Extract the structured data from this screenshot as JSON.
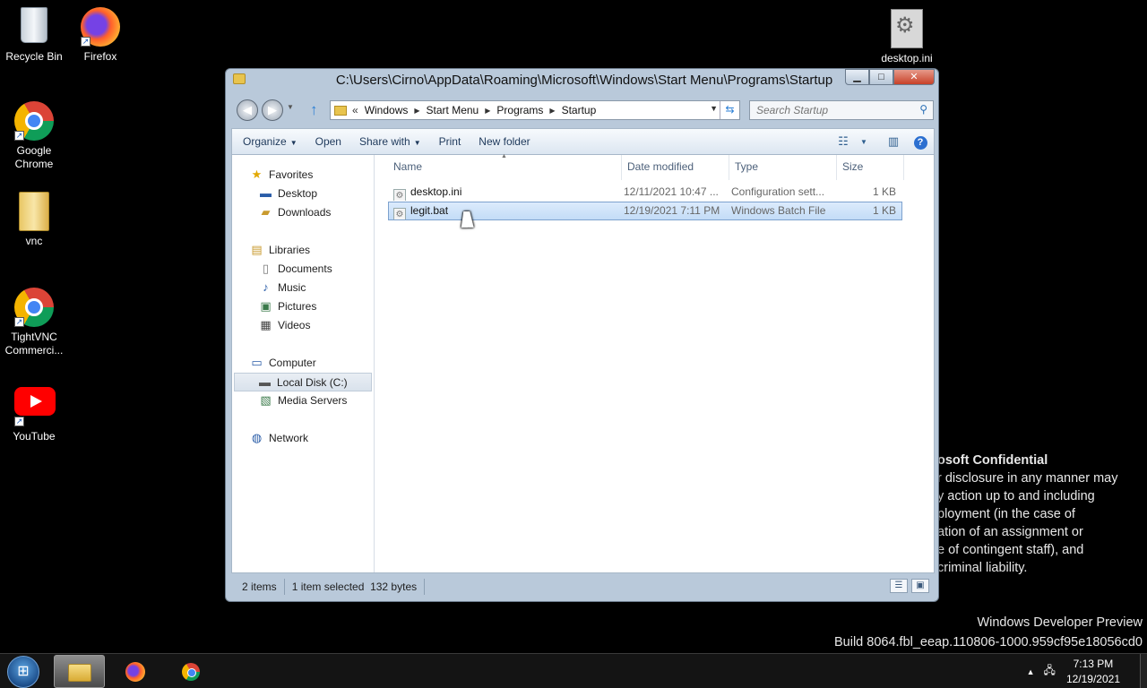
{
  "desktop": {
    "icons": [
      {
        "label": "Recycle Bin",
        "icon": "recycle-bin-icon"
      },
      {
        "label": "Firefox",
        "icon": "firefox-icon"
      },
      {
        "label": "Google Chrome",
        "icon": "chrome-icon"
      },
      {
        "label": "vnc",
        "icon": "folder-icon"
      },
      {
        "label": "TightVNC Commerci...",
        "icon": "chrome-icon"
      },
      {
        "label": "YouTube",
        "icon": "youtube-icon"
      },
      {
        "label": "desktop.ini",
        "icon": "settings-file-icon"
      }
    ],
    "watermark": {
      "title": "osoft Confidential",
      "lines": [
        "r disclosure in any manner may",
        "y action up to and including",
        "ployment (in the case of",
        "ation of an assignment or",
        "e of contingent staff), and",
        "criminal liability."
      ]
    },
    "build": {
      "line1": "Windows Developer Preview",
      "line2": "Build 8064.fbl_eeap.110806-1000.959cf95e18056cd0"
    }
  },
  "window": {
    "title": "C:\\Users\\Cirno\\AppData\\Roaming\\Microsoft\\Windows\\Start Menu\\Programs\\Startup",
    "controls": {
      "minimize": "▁",
      "maximize": "□",
      "close": "✕"
    },
    "address": {
      "overflow": "«",
      "crumbs": [
        "Windows",
        "Start Menu",
        "Programs",
        "Startup"
      ]
    },
    "search": {
      "placeholder": "Search Startup"
    },
    "toolbar": {
      "organize": "Organize",
      "open": "Open",
      "share_with": "Share with",
      "print": "Print",
      "new_folder": "New folder"
    },
    "navpane": {
      "favorites": "Favorites",
      "desktop": "Desktop",
      "downloads": "Downloads",
      "libraries": "Libraries",
      "documents": "Documents",
      "music": "Music",
      "pictures": "Pictures",
      "videos": "Videos",
      "computer": "Computer",
      "local_disk": "Local Disk (C:)",
      "media_servers": "Media Servers",
      "network": "Network"
    },
    "columns": {
      "name": "Name",
      "date": "Date modified",
      "type": "Type",
      "size": "Size"
    },
    "files": [
      {
        "name": "desktop.ini",
        "date": "12/11/2021 10:47 ...",
        "type": "Configuration sett...",
        "size": "1 KB",
        "selected": false
      },
      {
        "name": "legit.bat",
        "date": "12/19/2021 7:11 PM",
        "type": "Windows Batch File",
        "size": "1 KB",
        "selected": true
      }
    ],
    "status": {
      "items": "2 items",
      "selected": "1 item selected",
      "bytes": "132 bytes"
    }
  },
  "taskbar": {
    "start": "start-orb-icon",
    "pinned": [
      "explorer-icon",
      "firefox-icon",
      "chrome-icon"
    ],
    "clock": {
      "time": "7:13 PM",
      "date": "12/19/2021"
    }
  }
}
